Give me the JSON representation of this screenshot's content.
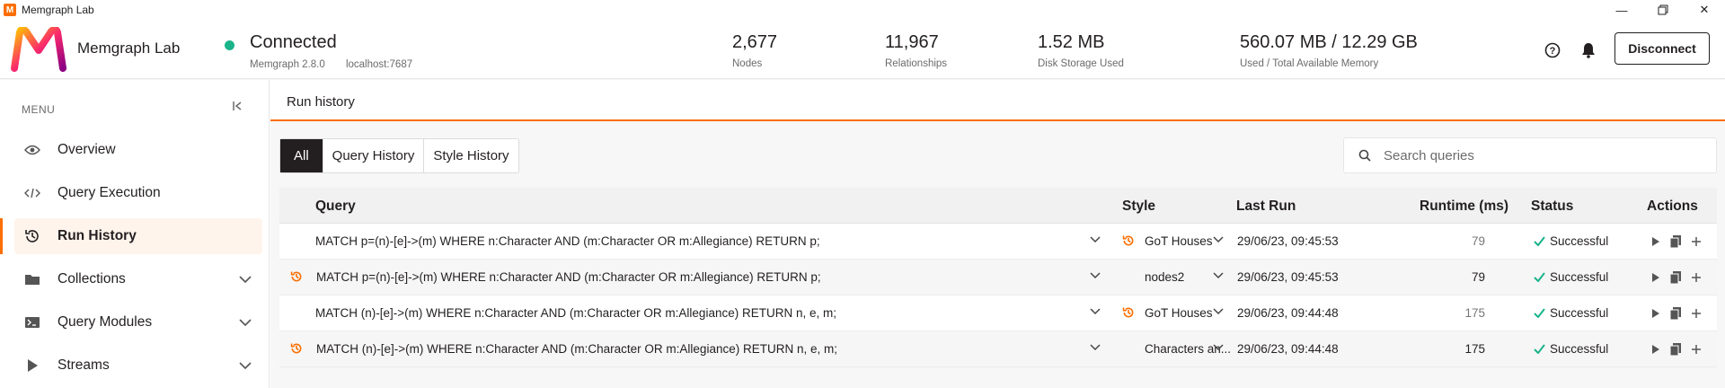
{
  "window": {
    "title": "Memgraph Lab",
    "app_icon_letter": "M"
  },
  "header": {
    "brand": "Memgraph Lab",
    "connection": {
      "status": "Connected",
      "version": "Memgraph 2.8.0",
      "host": "localhost:7687",
      "dot_color": "#1ab38a"
    },
    "stats": [
      {
        "value": "2,677",
        "label": "Nodes"
      },
      {
        "value": "11,967",
        "label": "Relationships"
      },
      {
        "value": "1.52 MB",
        "label": "Disk Storage Used"
      },
      {
        "value": "560.07 MB / 12.29 GB",
        "label": "Used / Total Available Memory"
      }
    ],
    "disconnect_label": "Disconnect"
  },
  "sidebar": {
    "menu_label": "MENU",
    "items": [
      {
        "label": "Overview",
        "icon": "eye-icon"
      },
      {
        "label": "Query Execution",
        "icon": "code-icon"
      },
      {
        "label": "Run History",
        "icon": "history-icon",
        "active": true
      },
      {
        "label": "Collections",
        "icon": "folder-icon"
      },
      {
        "label": "Query Modules",
        "icon": "terminal-icon"
      },
      {
        "label": "Streams",
        "icon": "play-icon"
      }
    ]
  },
  "main": {
    "title": "Run history",
    "tabs": [
      "All",
      "Query History",
      "Style History"
    ],
    "active_tab": "All",
    "search_placeholder": "Search queries",
    "columns": {
      "query": "Query",
      "style": "Style",
      "last_run": "Last Run",
      "runtime": "Runtime (ms)",
      "status": "Status",
      "actions": "Actions"
    },
    "rows": [
      {
        "query": "MATCH p=(n)-[e]->(m) WHERE n:Character AND (m:Character OR m:Allegiance) RETURN p;",
        "style": "GoT Houses",
        "last_run": "29/06/23, 09:45:53",
        "runtime": "79",
        "status": "Successful"
      },
      {
        "query": "MATCH p=(n)-[e]->(m) WHERE n:Character AND (m:Character OR m:Allegiance) RETURN p;",
        "style": "nodes2",
        "last_run": "29/06/23, 09:45:53",
        "runtime": "79",
        "status": "Successful"
      },
      {
        "query": "MATCH (n)-[e]->(m) WHERE n:Character AND (m:Character OR m:Allegiance) RETURN n, e, m;",
        "style": "GoT Houses",
        "last_run": "29/06/23, 09:44:48",
        "runtime": "175",
        "status": "Successful"
      },
      {
        "query": "MATCH (n)-[e]->(m) WHERE n:Character AND (m:Character OR m:Allegiance) RETURN n, e, m;",
        "style": "Characters an...",
        "last_run": "29/06/23, 09:44:48",
        "runtime": "175",
        "status": "Successful"
      }
    ]
  },
  "colors": {
    "accent": "#fb6e00",
    "success": "#1ab38a",
    "dark": "#231f20"
  }
}
